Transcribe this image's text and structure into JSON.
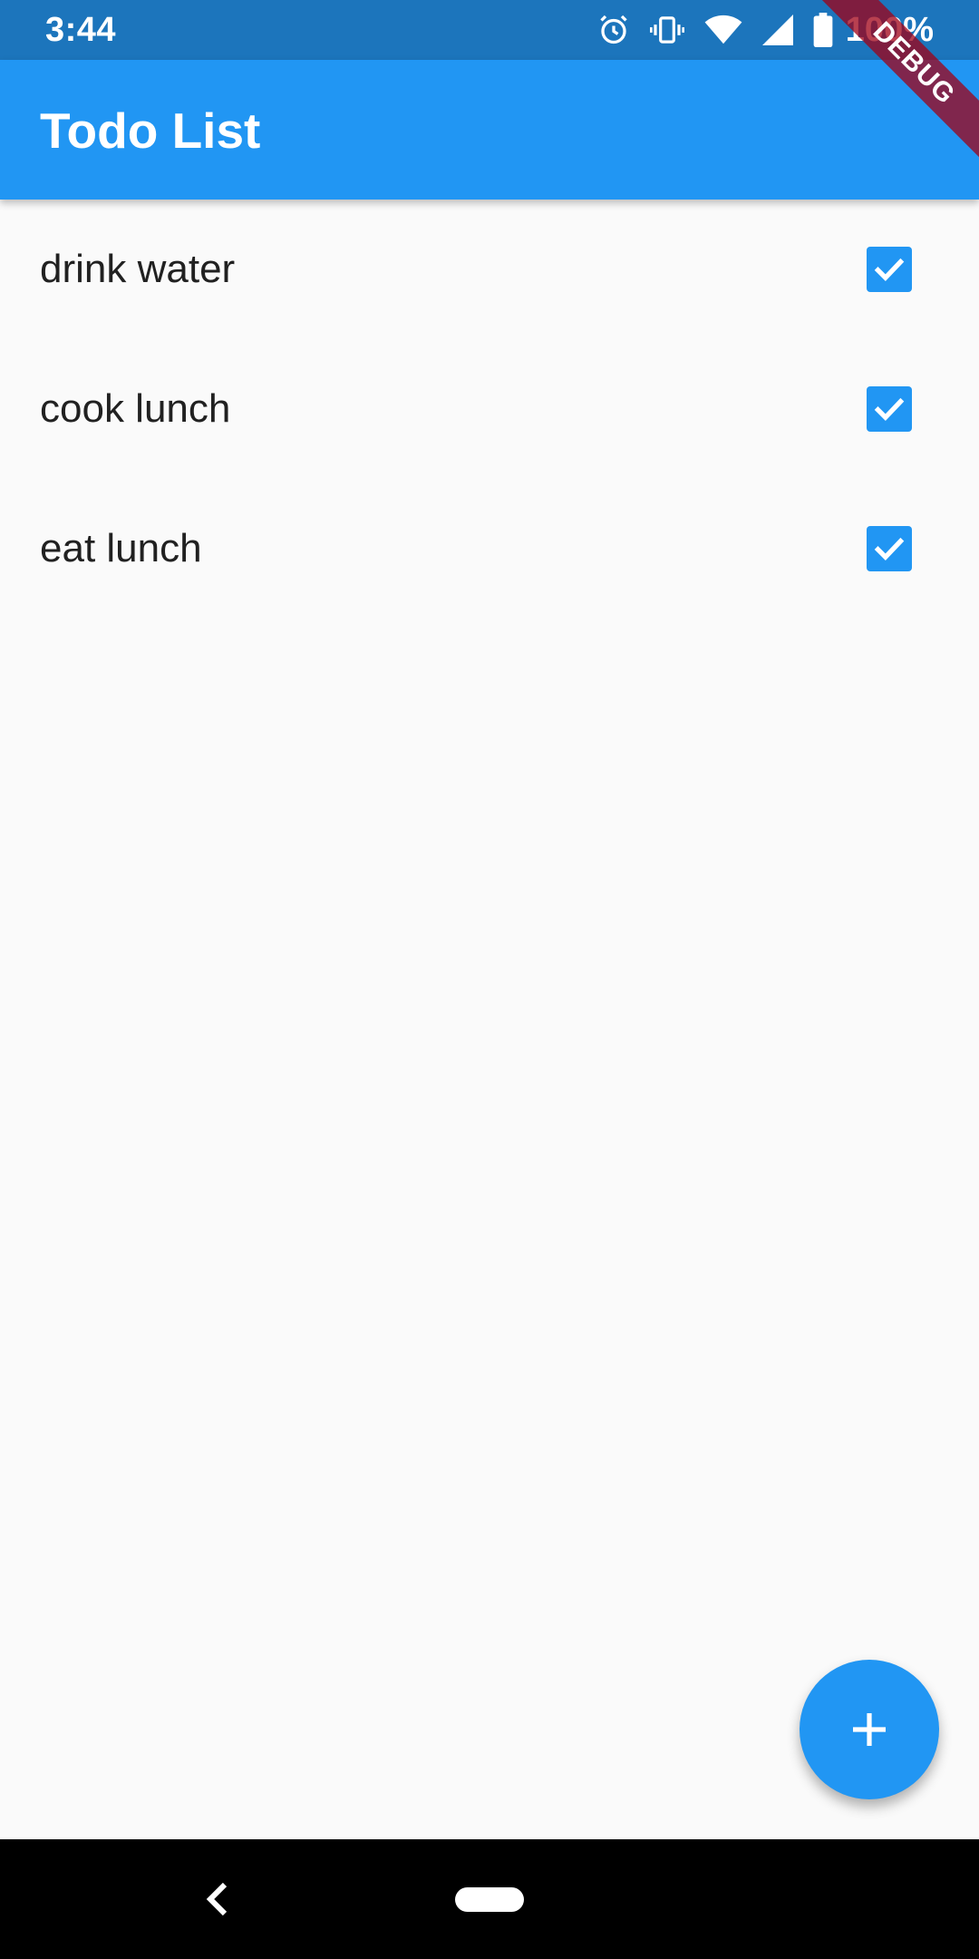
{
  "status_bar": {
    "time": "3:44",
    "battery_percent": "100%",
    "icons": [
      "alarm-icon",
      "vibrate-icon",
      "wifi-icon",
      "signal-icon",
      "battery-icon"
    ]
  },
  "app_bar": {
    "title": "Todo List"
  },
  "debug_banner": {
    "label": "DEBUG"
  },
  "todos": [
    {
      "label": "drink water",
      "checked": true
    },
    {
      "label": "cook lunch",
      "checked": true
    },
    {
      "label": "eat lunch",
      "checked": true
    }
  ],
  "fab": {
    "icon": "plus-icon"
  },
  "nav_bar": {
    "icons": [
      "back-icon",
      "home-pill-icon"
    ]
  },
  "colors": {
    "primary": "#2196F3",
    "status_bar": "#1C75BC",
    "background": "#FAFAFA",
    "text": "#212121",
    "debug": "#A00016"
  }
}
